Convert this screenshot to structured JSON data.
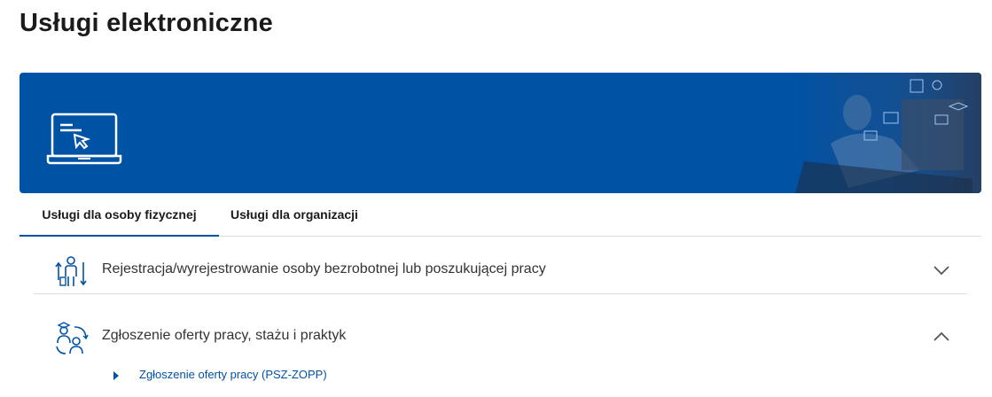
{
  "page": {
    "title": "Usługi elektroniczne"
  },
  "banner": {
    "icon": "laptop-cursor-icon",
    "background_color": "#0052a5"
  },
  "tabs": [
    {
      "label": "Usługi dla osoby fizycznej",
      "active": true
    },
    {
      "label": "Usługi dla organizacji",
      "active": false
    }
  ],
  "accordion": [
    {
      "label": "Rejestracja/wyrejestrowanie osoby bezrobotnej lub poszukującej pracy",
      "icon": "person-register-icon",
      "expanded": false
    },
    {
      "label": "Zgłoszenie oferty pracy, stażu i praktyk",
      "icon": "job-offer-people-icon",
      "expanded": true,
      "items": [
        {
          "label": "Zgłoszenie oferty pracy (PSZ-ZOPP)"
        }
      ]
    }
  ],
  "colors": {
    "accent": "#0052a5",
    "divider": "#dcdcdc",
    "text": "#1b1b1b"
  }
}
